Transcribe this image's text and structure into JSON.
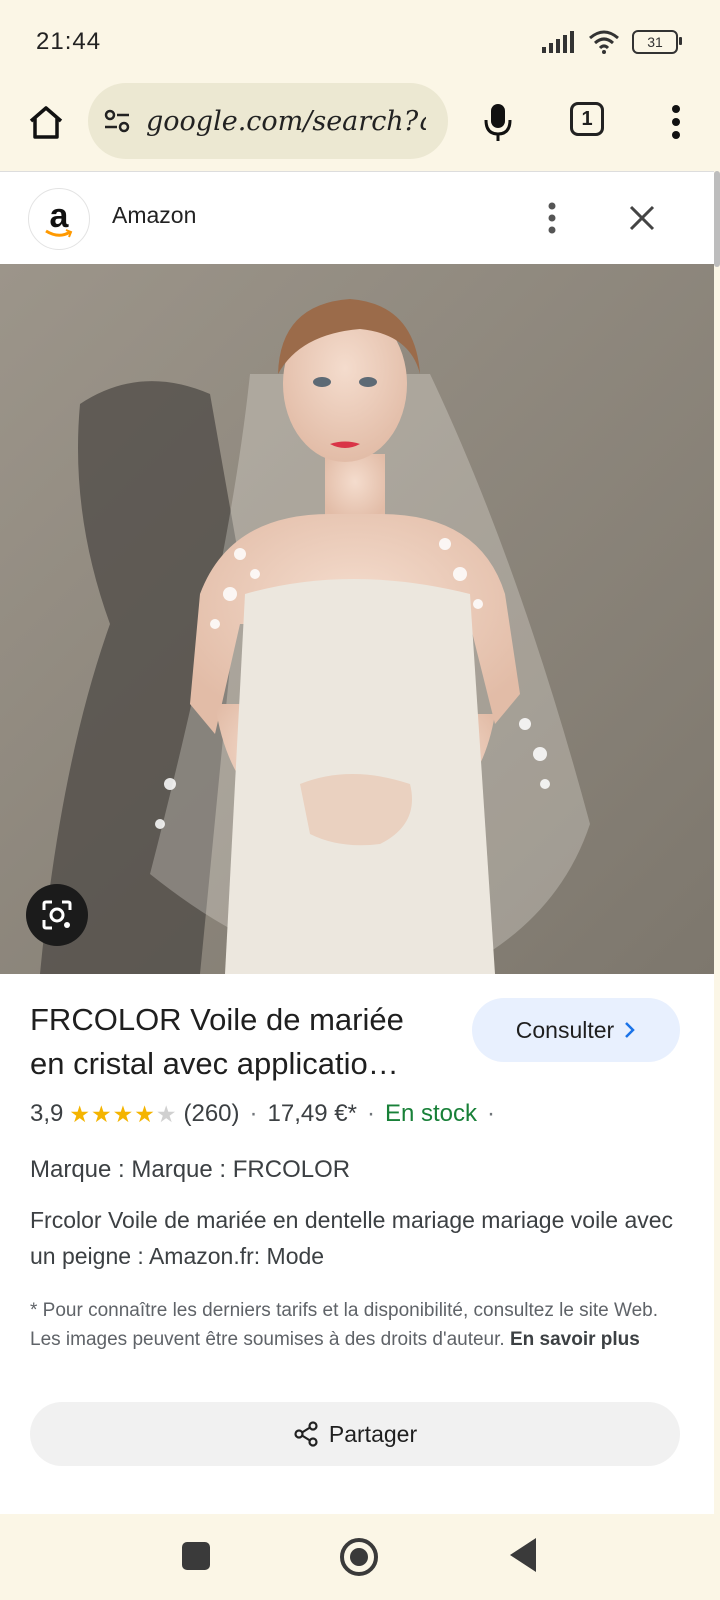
{
  "status_bar": {
    "time": "21:44",
    "battery": "31"
  },
  "browser": {
    "url": "google.com/search?q=",
    "tab_count": "1"
  },
  "source": {
    "name": "Amazon",
    "logo_letter": "a"
  },
  "product": {
    "title": "FRCOLOR Voile de mariée en cristal avec applicatio…",
    "consult_label": "Consulter",
    "rating": "3,9",
    "rating_value": 3.9,
    "rating_max": 5,
    "review_count": "(260)",
    "price": "17,49 €*",
    "availability": "En stock",
    "brand": "Marque : Marque : FRCOLOR",
    "description": "Frcolor Voile de mariée en dentelle mariage mariage voile avec un peigne : Amazon.fr: Mode",
    "disclaimer": "* Pour connaître les derniers tarifs et la disponibilité, consultez le site Web. Les images peuvent être soumises à des droits d'auteur.",
    "learn_more": "En savoir plus",
    "share_label": "Partager"
  },
  "colors": {
    "accent": "#e8f0fe",
    "stock_green": "#188038",
    "star": "#f4b400",
    "chrome_bg": "#fbf6e6"
  },
  "icons": {
    "home": "home-icon",
    "site_settings": "tune-icon",
    "mic": "mic-icon",
    "menu": "more-vert-icon",
    "close": "close-icon",
    "lens": "google-lens-icon",
    "share": "share-icon"
  }
}
